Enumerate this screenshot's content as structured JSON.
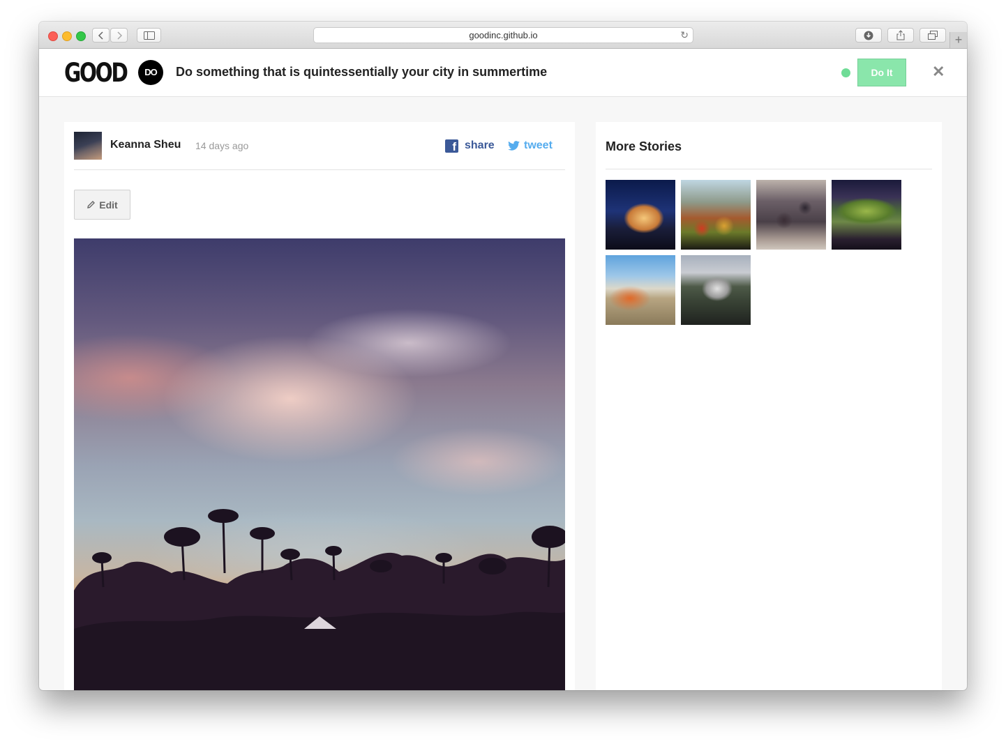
{
  "browser": {
    "url": "goodinc.github.io"
  },
  "header": {
    "logo": "GOOD",
    "badge": "DO",
    "headline": "Do something that is quintessentially your city in summertime",
    "doit_label": "Do It",
    "close_label": "✕"
  },
  "post": {
    "author": "Keanna Sheu",
    "time": "14 days ago",
    "share_label": "share",
    "tweet_label": "tweet",
    "edit_label": "Edit"
  },
  "sidebar": {
    "title": "More Stories",
    "thumbnails": [
      "story-thumbnail-1",
      "story-thumbnail-2",
      "story-thumbnail-3",
      "story-thumbnail-4",
      "story-thumbnail-5",
      "story-thumbnail-6"
    ]
  },
  "colors": {
    "accent_green": "#8ae6ab",
    "status_green": "#6fdc96",
    "facebook": "#3b5998",
    "twitter": "#55acee"
  }
}
